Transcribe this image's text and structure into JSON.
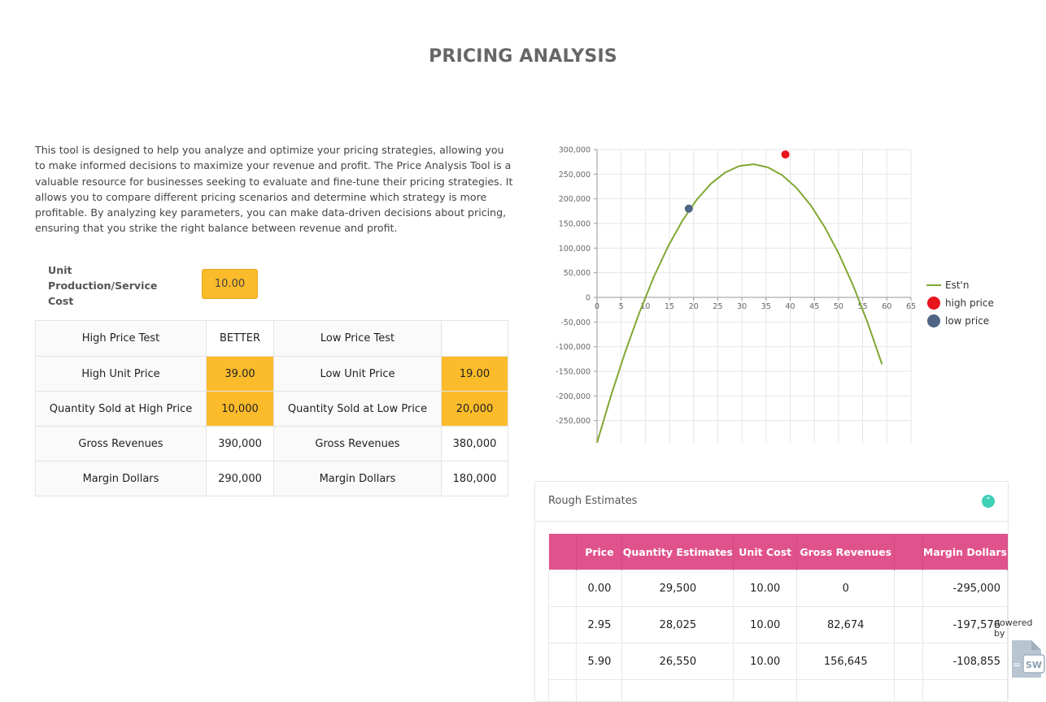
{
  "page": {
    "title": "PRICING ANALYSIS"
  },
  "intro": "This tool is designed to help you analyze and optimize your pricing strategies, allowing you to make informed decisions to maximize your revenue and profit. The Price Analysis Tool is a valuable resource for businesses seeking to evaluate and fine-tune their pricing strategies. It allows you to compare different pricing scenarios and determine which strategy is more profitable. By analyzing key parameters, you can make data-driven decisions about pricing, ensuring that you strike the right balance between revenue and profit.",
  "cost": {
    "label": "Unit Production/Service Cost",
    "value": "10.00"
  },
  "price_table": {
    "header": {
      "high": "High Price Test",
      "verdict": "BETTER",
      "low": "Low Price Test",
      "low_verdict": ""
    },
    "rows": [
      {
        "high_label": "High Unit Price",
        "high_value": "39.00",
        "low_label": "Low Unit Price",
        "low_value": "19.00"
      },
      {
        "high_label": "Quantity Sold at High Price",
        "high_value": "10,000",
        "low_label": "Quantity Sold at Low Price",
        "low_value": "20,000"
      },
      {
        "high_label": "Gross Revenues",
        "high_value": "390,000",
        "low_label": "Gross Revenues",
        "low_value": "380,000"
      },
      {
        "high_label": "Margin Dollars",
        "high_value": "290,000",
        "low_label": "Margin Dollars",
        "low_value": "180,000"
      }
    ]
  },
  "chart_data": {
    "type": "line",
    "xlim": [
      0,
      65
    ],
    "ylim": [
      -295000,
      300000
    ],
    "x_ticks": [
      0,
      5,
      10,
      15,
      20,
      25,
      30,
      35,
      40,
      45,
      50,
      55,
      60,
      65
    ],
    "y_ticks": [
      300000,
      250000,
      200000,
      150000,
      100000,
      50000,
      0,
      -50000,
      -100000,
      -150000,
      -200000,
      -250000
    ],
    "grid": true,
    "legend_position": "right",
    "series": [
      {
        "name": "Est'n",
        "type": "line",
        "color": "#7fa832",
        "x": [
          0,
          2.95,
          5.9,
          8.85,
          11.8,
          14.75,
          17.7,
          20.65,
          23.6,
          26.55,
          29.5,
          32.45,
          35.4,
          38.35,
          41.3,
          44.25,
          47.2,
          50.15,
          53.1,
          56.05,
          59
        ],
        "y": [
          -295000,
          -197576,
          -108855,
          -28838,
          42476,
          104088,
          156000,
          198212,
          230724,
          253535,
          266646,
          270057,
          263768,
          247778,
          222089,
          186700,
          141610,
          86821,
          22332,
          -51858,
          -135750
        ]
      },
      {
        "name": "high price",
        "type": "point",
        "color": "#e8141b",
        "x": [
          39
        ],
        "y": [
          290000
        ]
      },
      {
        "name": "low price",
        "type": "point",
        "color": "#4f6584",
        "x": [
          19
        ],
        "y": [
          180000
        ]
      }
    ]
  },
  "estimates": {
    "panel_title": "Rough Estimates",
    "columns": [
      "",
      "Price",
      "Quantity Estimates",
      "Unit Cost",
      "Gross Revenues",
      "",
      "Margin Dollars"
    ],
    "rows": [
      [
        "",
        "0.00",
        "29,500",
        "10.00",
        "0",
        "",
        "-295,000"
      ],
      [
        "",
        "2.95",
        "28,025",
        "10.00",
        "82,674",
        "",
        "-197,576"
      ],
      [
        "",
        "5.90",
        "26,550",
        "10.00",
        "156,645",
        "",
        "-108,855"
      ],
      [
        "",
        "",
        "",
        "",
        "",
        "",
        ""
      ]
    ]
  },
  "footer": {
    "powered_by": "powered by",
    "logo_text": "SW"
  }
}
